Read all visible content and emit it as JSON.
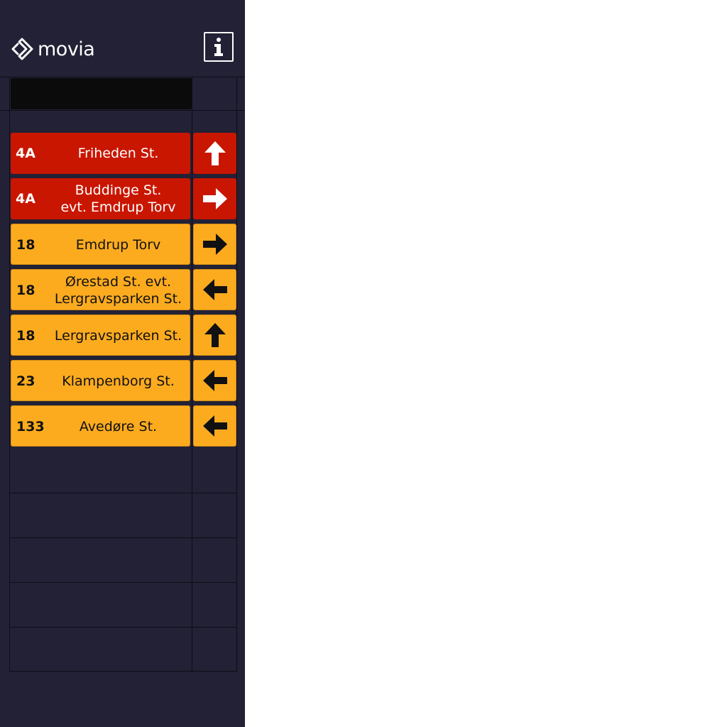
{
  "header": {
    "logo_text": "movia",
    "info_icon": "info-icon",
    "logo_icon": "movia-logo-mark-icon"
  },
  "colors": {
    "panel": "#222135",
    "red": "#c91600",
    "yellow": "#fcab1f",
    "search_field": "#0b0b0c"
  },
  "departures": [
    {
      "route": "4A",
      "destination": "Friheden St.",
      "color": "red",
      "arrow": "up"
    },
    {
      "route": "4A",
      "destination": "Buddinge St.\nevt. Emdrup Torv",
      "color": "red",
      "arrow": "right"
    },
    {
      "route": "18",
      "destination": "Emdrup Torv",
      "color": "yellow",
      "arrow": "right"
    },
    {
      "route": "18",
      "destination": "Ørestad St. evt.\nLergravsparken St.",
      "color": "yellow",
      "arrow": "left"
    },
    {
      "route": "18",
      "destination": "Lergravsparken St.",
      "color": "yellow",
      "arrow": "up"
    },
    {
      "route": "23",
      "destination": "Klampenborg St.",
      "color": "yellow",
      "arrow": "left"
    },
    {
      "route": "133",
      "destination": "Avedøre St.",
      "color": "yellow",
      "arrow": "left"
    }
  ]
}
